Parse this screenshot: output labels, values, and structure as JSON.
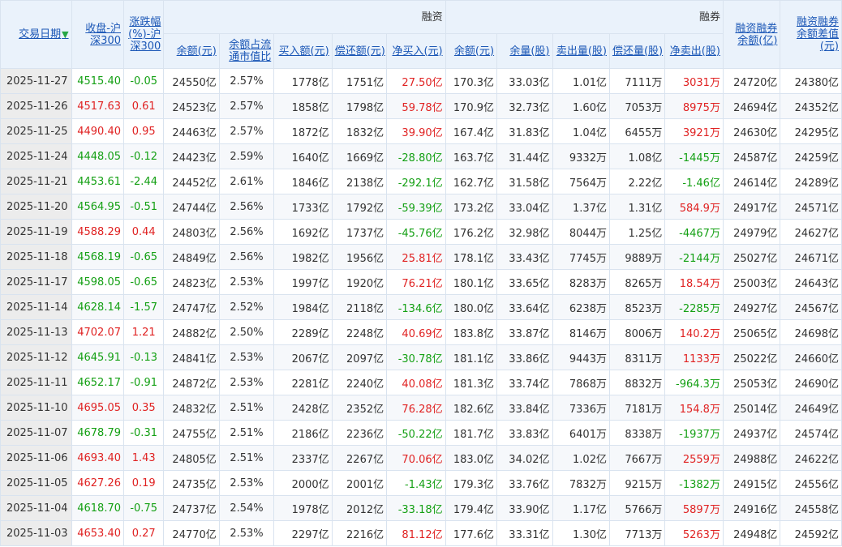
{
  "headers": {
    "date": "交易日期",
    "close_line1": "收盘-沪",
    "close_line2": "深300",
    "chg_line1": "涨跌幅",
    "chg_line2": "(%)-沪",
    "chg_line3": "深300",
    "group_margin": "融资",
    "group_short": "融券",
    "balance_line1": "融资融券",
    "balance_line2": "余额(亿)",
    "diff_line1": "融资融券",
    "diff_line2": "余额差值",
    "diff_line3": "(元)",
    "m_amount": "余额(元)",
    "m_ratio_line1": "余额占流",
    "m_ratio_line2": "通市值比",
    "m_buy": "买入额(元)",
    "m_repay": "偿还额(元)",
    "m_net": "净买入(元)",
    "s_amount": "余额(元)",
    "s_qty": "余量(股)",
    "s_sell": "卖出量(股)",
    "s_repay": "偿还量(股)",
    "s_net": "净卖出(股)"
  },
  "colors": {
    "up": "#e02222",
    "down": "#14a014",
    "link": "#1a56b6",
    "header_bg": "#eaf2fb"
  },
  "rows": [
    {
      "date": "2025-11-27",
      "close": "4515.40",
      "chg": "-0.05",
      "dir": "down",
      "m_amount": "24550亿",
      "m_ratio": "2.57%",
      "m_buy": "1778亿",
      "m_repay": "1751亿",
      "m_net": "27.50亿",
      "m_net_dir": "up",
      "s_amount": "170.3亿",
      "s_qty": "33.03亿",
      "s_sell": "1.01亿",
      "s_repay": "7111万",
      "s_net": "3031万",
      "s_net_dir": "up",
      "balance": "24720亿",
      "diff": "24380亿"
    },
    {
      "date": "2025-11-26",
      "close": "4517.63",
      "chg": "0.61",
      "dir": "up",
      "m_amount": "24523亿",
      "m_ratio": "2.57%",
      "m_buy": "1858亿",
      "m_repay": "1798亿",
      "m_net": "59.78亿",
      "m_net_dir": "up",
      "s_amount": "170.9亿",
      "s_qty": "32.73亿",
      "s_sell": "1.60亿",
      "s_repay": "7053万",
      "s_net": "8975万",
      "s_net_dir": "up",
      "balance": "24694亿",
      "diff": "24352亿"
    },
    {
      "date": "2025-11-25",
      "close": "4490.40",
      "chg": "0.95",
      "dir": "up",
      "m_amount": "24463亿",
      "m_ratio": "2.57%",
      "m_buy": "1872亿",
      "m_repay": "1832亿",
      "m_net": "39.90亿",
      "m_net_dir": "up",
      "s_amount": "167.4亿",
      "s_qty": "31.83亿",
      "s_sell": "1.04亿",
      "s_repay": "6455万",
      "s_net": "3921万",
      "s_net_dir": "up",
      "balance": "24630亿",
      "diff": "24295亿"
    },
    {
      "date": "2025-11-24",
      "close": "4448.05",
      "chg": "-0.12",
      "dir": "down",
      "m_amount": "24423亿",
      "m_ratio": "2.59%",
      "m_buy": "1640亿",
      "m_repay": "1669亿",
      "m_net": "-28.80亿",
      "m_net_dir": "down",
      "s_amount": "163.7亿",
      "s_qty": "31.44亿",
      "s_sell": "9332万",
      "s_repay": "1.08亿",
      "s_net": "-1445万",
      "s_net_dir": "down",
      "balance": "24587亿",
      "diff": "24259亿"
    },
    {
      "date": "2025-11-21",
      "close": "4453.61",
      "chg": "-2.44",
      "dir": "down",
      "m_amount": "24452亿",
      "m_ratio": "2.61%",
      "m_buy": "1846亿",
      "m_repay": "2138亿",
      "m_net": "-292.1亿",
      "m_net_dir": "down",
      "s_amount": "162.7亿",
      "s_qty": "31.58亿",
      "s_sell": "7564万",
      "s_repay": "2.22亿",
      "s_net": "-1.46亿",
      "s_net_dir": "down",
      "balance": "24614亿",
      "diff": "24289亿"
    },
    {
      "date": "2025-11-20",
      "close": "4564.95",
      "chg": "-0.51",
      "dir": "down",
      "m_amount": "24744亿",
      "m_ratio": "2.56%",
      "m_buy": "1733亿",
      "m_repay": "1792亿",
      "m_net": "-59.39亿",
      "m_net_dir": "down",
      "s_amount": "173.2亿",
      "s_qty": "33.04亿",
      "s_sell": "1.37亿",
      "s_repay": "1.31亿",
      "s_net": "584.9万",
      "s_net_dir": "up",
      "balance": "24917亿",
      "diff": "24571亿"
    },
    {
      "date": "2025-11-19",
      "close": "4588.29",
      "chg": "0.44",
      "dir": "up",
      "m_amount": "24803亿",
      "m_ratio": "2.56%",
      "m_buy": "1692亿",
      "m_repay": "1737亿",
      "m_net": "-45.76亿",
      "m_net_dir": "down",
      "s_amount": "176.2亿",
      "s_qty": "32.98亿",
      "s_sell": "8044万",
      "s_repay": "1.25亿",
      "s_net": "-4467万",
      "s_net_dir": "down",
      "balance": "24979亿",
      "diff": "24627亿"
    },
    {
      "date": "2025-11-18",
      "close": "4568.19",
      "chg": "-0.65",
      "dir": "down",
      "m_amount": "24849亿",
      "m_ratio": "2.56%",
      "m_buy": "1982亿",
      "m_repay": "1956亿",
      "m_net": "25.81亿",
      "m_net_dir": "up",
      "s_amount": "178.1亿",
      "s_qty": "33.43亿",
      "s_sell": "7745万",
      "s_repay": "9889万",
      "s_net": "-2144万",
      "s_net_dir": "down",
      "balance": "25027亿",
      "diff": "24671亿"
    },
    {
      "date": "2025-11-17",
      "close": "4598.05",
      "chg": "-0.65",
      "dir": "down",
      "m_amount": "24823亿",
      "m_ratio": "2.53%",
      "m_buy": "1997亿",
      "m_repay": "1920亿",
      "m_net": "76.21亿",
      "m_net_dir": "up",
      "s_amount": "180.1亿",
      "s_qty": "33.65亿",
      "s_sell": "8283万",
      "s_repay": "8265万",
      "s_net": "18.54万",
      "s_net_dir": "up",
      "balance": "25003亿",
      "diff": "24643亿"
    },
    {
      "date": "2025-11-14",
      "close": "4628.14",
      "chg": "-1.57",
      "dir": "down",
      "m_amount": "24747亿",
      "m_ratio": "2.52%",
      "m_buy": "1984亿",
      "m_repay": "2118亿",
      "m_net": "-134.6亿",
      "m_net_dir": "down",
      "s_amount": "180.0亿",
      "s_qty": "33.64亿",
      "s_sell": "6238万",
      "s_repay": "8523万",
      "s_net": "-2285万",
      "s_net_dir": "down",
      "balance": "24927亿",
      "diff": "24567亿"
    },
    {
      "date": "2025-11-13",
      "close": "4702.07",
      "chg": "1.21",
      "dir": "up",
      "m_amount": "24882亿",
      "m_ratio": "2.50%",
      "m_buy": "2289亿",
      "m_repay": "2248亿",
      "m_net": "40.69亿",
      "m_net_dir": "up",
      "s_amount": "183.8亿",
      "s_qty": "33.87亿",
      "s_sell": "8146万",
      "s_repay": "8006万",
      "s_net": "140.2万",
      "s_net_dir": "up",
      "balance": "25065亿",
      "diff": "24698亿"
    },
    {
      "date": "2025-11-12",
      "close": "4645.91",
      "chg": "-0.13",
      "dir": "down",
      "m_amount": "24841亿",
      "m_ratio": "2.53%",
      "m_buy": "2067亿",
      "m_repay": "2097亿",
      "m_net": "-30.78亿",
      "m_net_dir": "down",
      "s_amount": "181.1亿",
      "s_qty": "33.86亿",
      "s_sell": "9443万",
      "s_repay": "8311万",
      "s_net": "1133万",
      "s_net_dir": "up",
      "balance": "25022亿",
      "diff": "24660亿"
    },
    {
      "date": "2025-11-11",
      "close": "4652.17",
      "chg": "-0.91",
      "dir": "down",
      "m_amount": "24872亿",
      "m_ratio": "2.53%",
      "m_buy": "2281亿",
      "m_repay": "2240亿",
      "m_net": "40.08亿",
      "m_net_dir": "up",
      "s_amount": "181.3亿",
      "s_qty": "33.74亿",
      "s_sell": "7868万",
      "s_repay": "8832万",
      "s_net": "-964.3万",
      "s_net_dir": "down",
      "balance": "25053亿",
      "diff": "24690亿"
    },
    {
      "date": "2025-11-10",
      "close": "4695.05",
      "chg": "0.35",
      "dir": "up",
      "m_amount": "24832亿",
      "m_ratio": "2.51%",
      "m_buy": "2428亿",
      "m_repay": "2352亿",
      "m_net": "76.28亿",
      "m_net_dir": "up",
      "s_amount": "182.6亿",
      "s_qty": "33.84亿",
      "s_sell": "7336万",
      "s_repay": "7181万",
      "s_net": "154.8万",
      "s_net_dir": "up",
      "balance": "25014亿",
      "diff": "24649亿"
    },
    {
      "date": "2025-11-07",
      "close": "4678.79",
      "chg": "-0.31",
      "dir": "down",
      "m_amount": "24755亿",
      "m_ratio": "2.51%",
      "m_buy": "2186亿",
      "m_repay": "2236亿",
      "m_net": "-50.22亿",
      "m_net_dir": "down",
      "s_amount": "181.7亿",
      "s_qty": "33.83亿",
      "s_sell": "6401万",
      "s_repay": "8338万",
      "s_net": "-1937万",
      "s_net_dir": "down",
      "balance": "24937亿",
      "diff": "24574亿"
    },
    {
      "date": "2025-11-06",
      "close": "4693.40",
      "chg": "1.43",
      "dir": "up",
      "m_amount": "24805亿",
      "m_ratio": "2.51%",
      "m_buy": "2337亿",
      "m_repay": "2267亿",
      "m_net": "70.06亿",
      "m_net_dir": "up",
      "s_amount": "183.0亿",
      "s_qty": "34.02亿",
      "s_sell": "1.02亿",
      "s_repay": "7667万",
      "s_net": "2559万",
      "s_net_dir": "up",
      "balance": "24988亿",
      "diff": "24622亿"
    },
    {
      "date": "2025-11-05",
      "close": "4627.26",
      "chg": "0.19",
      "dir": "up",
      "m_amount": "24735亿",
      "m_ratio": "2.53%",
      "m_buy": "2000亿",
      "m_repay": "2001亿",
      "m_net": "-1.43亿",
      "m_net_dir": "down",
      "s_amount": "179.3亿",
      "s_qty": "33.76亿",
      "s_sell": "7832万",
      "s_repay": "9215万",
      "s_net": "-1382万",
      "s_net_dir": "down",
      "balance": "24915亿",
      "diff": "24556亿"
    },
    {
      "date": "2025-11-04",
      "close": "4618.70",
      "chg": "-0.75",
      "dir": "down",
      "m_amount": "24737亿",
      "m_ratio": "2.54%",
      "m_buy": "1978亿",
      "m_repay": "2012亿",
      "m_net": "-33.18亿",
      "m_net_dir": "down",
      "s_amount": "179.4亿",
      "s_qty": "33.90亿",
      "s_sell": "1.17亿",
      "s_repay": "5766万",
      "s_net": "5897万",
      "s_net_dir": "up",
      "balance": "24916亿",
      "diff": "24558亿"
    },
    {
      "date": "2025-11-03",
      "close": "4653.40",
      "chg": "0.27",
      "dir": "up",
      "m_amount": "24770亿",
      "m_ratio": "2.53%",
      "m_buy": "2297亿",
      "m_repay": "2216亿",
      "m_net": "81.12亿",
      "m_net_dir": "up",
      "s_amount": "177.6亿",
      "s_qty": "33.31亿",
      "s_sell": "1.30亿",
      "s_repay": "7713万",
      "s_net": "5263万",
      "s_net_dir": "up",
      "balance": "24948亿",
      "diff": "24592亿"
    }
  ]
}
